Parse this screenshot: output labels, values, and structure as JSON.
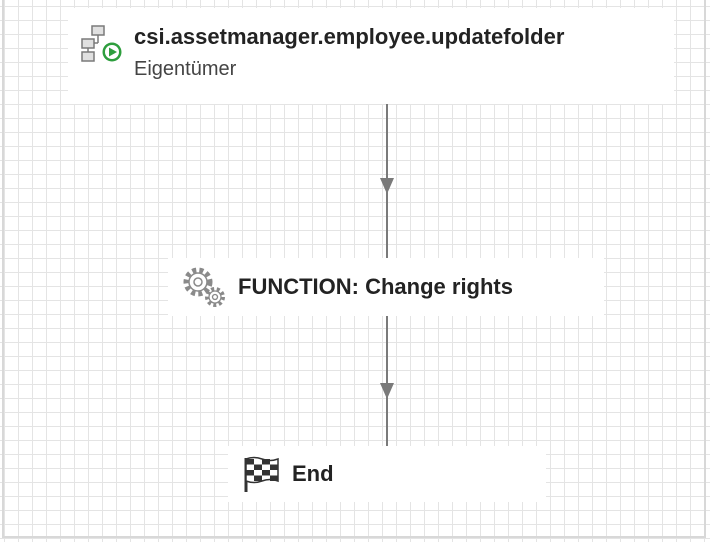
{
  "workflow": {
    "start_node": {
      "title": "csi.assetmanager.employee.updatefolder",
      "subtitle": "Eigentümer",
      "icon": "workflow-start-icon"
    },
    "function_node": {
      "title": "FUNCTION: Change rights",
      "icon": "gears-icon"
    },
    "end_node": {
      "title": "End",
      "icon": "checkered-flag-icon"
    }
  },
  "colors": {
    "canvas_background": "#ffffff",
    "grid_line": "#e4e4e4",
    "node_background": "#ffffff",
    "connector": "#7a7a7a",
    "start_icon_accent": "#2e9e3e",
    "text": "#232323"
  }
}
